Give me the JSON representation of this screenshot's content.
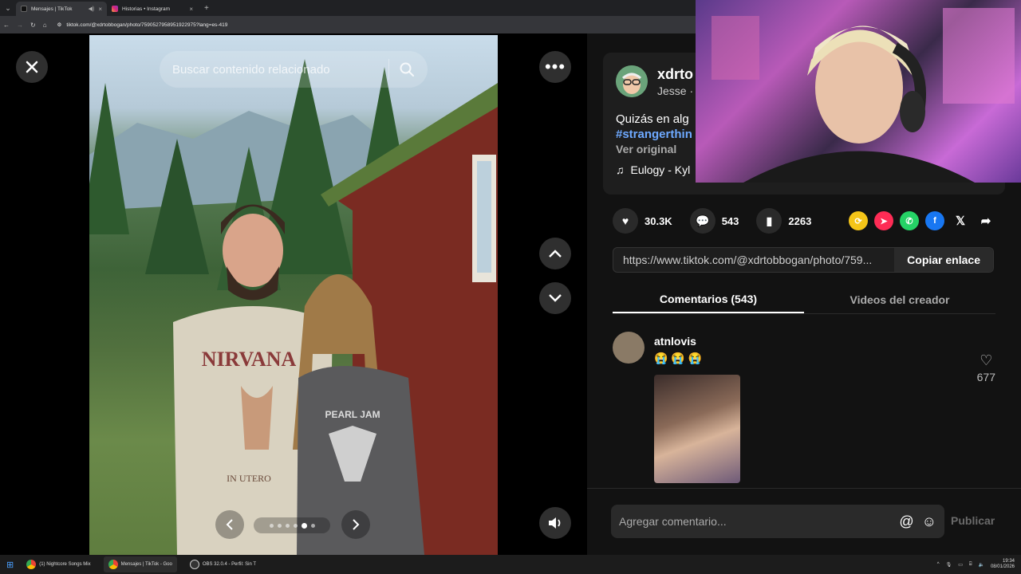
{
  "browser": {
    "tabs": [
      {
        "title": "Mensajes | TikTok",
        "active": true
      },
      {
        "title": "Historias • Instagram",
        "active": false
      }
    ],
    "url": "tiktok.com/@xdrtobbogan/photo/7590527958951922975?lang=es-419"
  },
  "viewer": {
    "search_placeholder": "Buscar contenido relacionado",
    "photo_caption_visible": [
      "NIRVANA",
      "IN UTERO",
      "PEARL JAM"
    ],
    "carousel": {
      "total": 6,
      "active_index": 4
    }
  },
  "post": {
    "username": "xdrto",
    "nickname": "Jesse ·",
    "caption": "Quizás en alg",
    "hashtag": "#strangerthin",
    "see_original": "Ver original",
    "music": "Eulogy - Kyl",
    "likes": "30.3K",
    "comments": "543",
    "saves": "2263",
    "link": "https://www.tiktok.com/@xdrtobbogan/photo/759...",
    "copy_label": "Copiar enlace"
  },
  "panel_tabs": [
    {
      "label": "Comentarios (543)",
      "active": true
    },
    {
      "label": "Videos del creador",
      "active": false
    }
  ],
  "comment": {
    "user": "atnlovis",
    "emojis": "😭😭😭",
    "likes": "677"
  },
  "composer": {
    "placeholder": "Agregar comentario...",
    "publish": "Publicar"
  },
  "taskbar": {
    "items": [
      "(1) Nightcore Songs Mix",
      "Mensajes | TikTok - Goo",
      "OBS 32.0.4 - Perfil: Sin T"
    ],
    "time": "19:34",
    "date": "08/01/2026"
  }
}
